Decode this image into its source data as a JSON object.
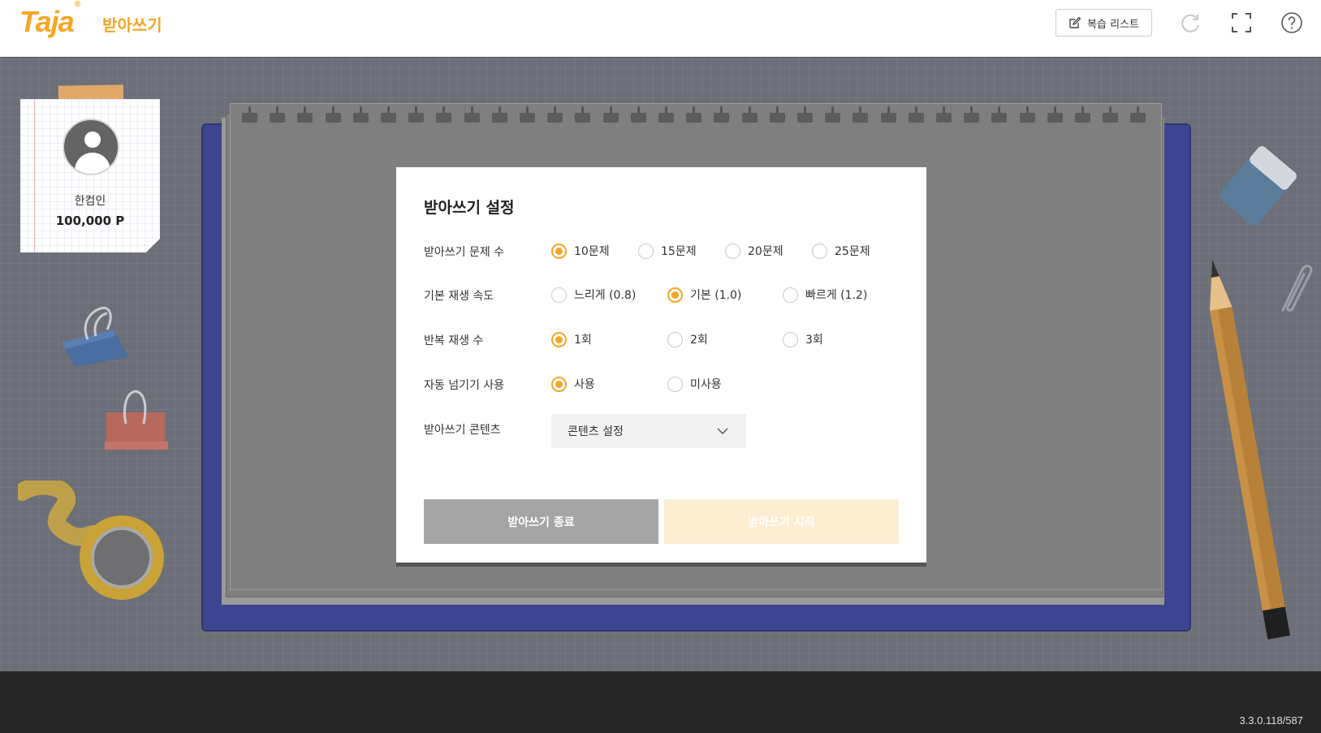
{
  "header": {
    "logo": "Taja",
    "logo_mark": "®",
    "app_title": "받아쓰기",
    "review_button": "복습 리스트",
    "icons": [
      "edit-icon",
      "refresh-icon",
      "fullscreen-icon",
      "help-icon"
    ]
  },
  "profile": {
    "name": "한컴인",
    "points": "100,000 P"
  },
  "modal": {
    "title": "받아쓰기 설정",
    "rows": [
      {
        "label": "받아쓰기 문제 수",
        "options": [
          {
            "label": "10문제",
            "selected": true
          },
          {
            "label": "15문제",
            "selected": false
          },
          {
            "label": "20문제",
            "selected": false
          },
          {
            "label": "25문제",
            "selected": false
          }
        ]
      },
      {
        "label": "기본 재생 속도",
        "options": [
          {
            "label": "느리게 (0.8)",
            "selected": false
          },
          {
            "label": "기본 (1.0)",
            "selected": true
          },
          {
            "label": "빠르게 (1.2)",
            "selected": false
          }
        ]
      },
      {
        "label": "반복 재생 수",
        "options": [
          {
            "label": "1회",
            "selected": true
          },
          {
            "label": "2회",
            "selected": false
          },
          {
            "label": "3회",
            "selected": false
          }
        ]
      },
      {
        "label": "자동 넘기기 사용",
        "options": [
          {
            "label": "사용",
            "selected": true
          },
          {
            "label": "미사용",
            "selected": false
          }
        ]
      }
    ],
    "content_label": "받아쓰기 콘텐츠",
    "content_select": "콘텐츠 설정",
    "end_button": "받아쓰기 종료",
    "start_button": "받아쓰기 시작"
  },
  "footer": {
    "version": "3.3.0.118/587"
  },
  "colors": {
    "accent": "#f5a623",
    "notebook_cover": "#3e4590",
    "workspace": "#6c6f78",
    "footer": "#262626"
  }
}
